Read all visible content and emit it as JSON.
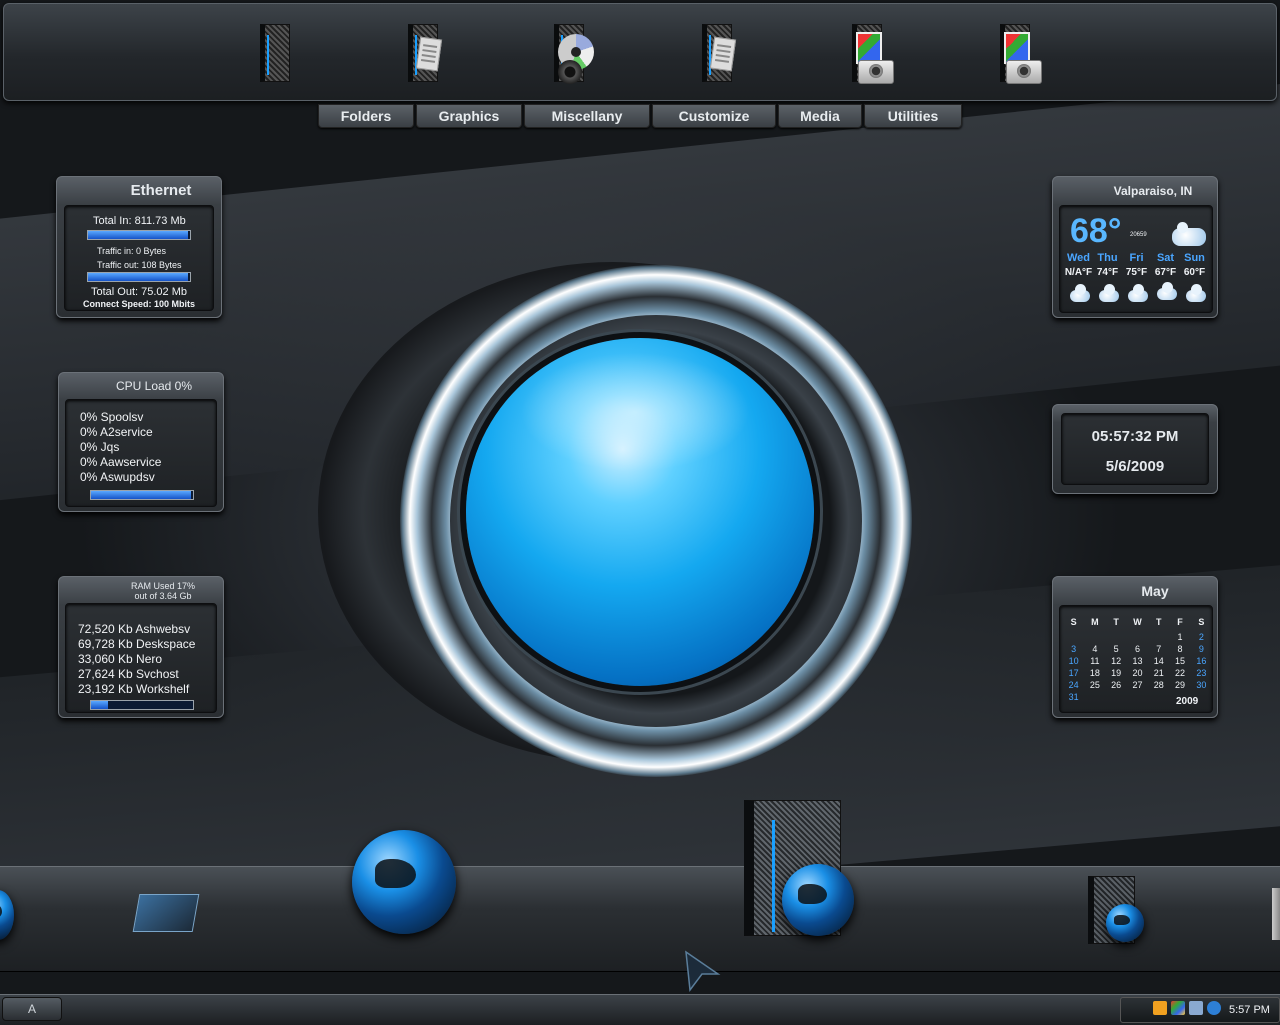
{
  "top_dock": {
    "items": [
      {
        "icon": "folder-icon"
      },
      {
        "icon": "documents-folder-icon"
      },
      {
        "icon": "music-folder-icon"
      },
      {
        "icon": "documents-folder-icon"
      },
      {
        "icon": "pictures-folder-icon"
      },
      {
        "icon": "pictures-folder-icon"
      }
    ]
  },
  "tabs": [
    "Folders",
    "Graphics",
    "Miscellany",
    "Customize",
    "Media",
    "Utilities"
  ],
  "ethernet": {
    "title": "Ethernet",
    "total_in": "Total In: 811.73 Mb",
    "traffic_in": "Traffic in: 0 Bytes",
    "traffic_out": "Traffic out: 108 Bytes",
    "total_out": "Total Out: 75.02 Mb",
    "speed": "Connect Speed: 100 Mbits",
    "in_level": 0.98,
    "out_level": 0.98
  },
  "cpu": {
    "title": "CPU Load 0%",
    "processes": [
      "0% Spoolsv",
      "0% A2service",
      "0% Jqs",
      "0% Aawservice",
      "0% Aswupdsv"
    ],
    "level": 0.98
  },
  "ram": {
    "title_line1": "RAM Used 17%",
    "title_line2": "out of 3.64 Gb",
    "processes": [
      "72,520 Kb Ashwebsv",
      "69,728 Kb Deskspace",
      "33,060 Kb Nero",
      "27,624 Kb Svchost",
      "23,192 Kb Workshelf"
    ],
    "level": 0.17
  },
  "weather": {
    "location": "Valparaiso, IN",
    "temp": "68°",
    "code": "20659",
    "days": [
      "Wed",
      "Thu",
      "Fri",
      "Sat",
      "Sun"
    ],
    "highs": [
      "N/A°F",
      "74°F",
      "75°F",
      "67°F",
      "60°F"
    ],
    "icons": [
      "partly-cloudy-icon",
      "rain-icon",
      "partly-cloudy-icon",
      "cloudy-icon",
      "partly-cloudy-icon"
    ]
  },
  "clock": {
    "time": "05:57:32 PM",
    "date": "5/6/2009"
  },
  "calendar": {
    "month": "May",
    "year": "2009",
    "weekdays": [
      "S",
      "M",
      "T",
      "W",
      "T",
      "F",
      "S"
    ],
    "weeks": [
      [
        "",
        "",
        "",
        "",
        "",
        "1",
        "2"
      ],
      [
        "3",
        "4",
        "5",
        "6",
        "7",
        "8",
        "9"
      ],
      [
        "10",
        "11",
        "12",
        "13",
        "14",
        "15",
        "16"
      ],
      [
        "17",
        "18",
        "19",
        "20",
        "21",
        "22",
        "23"
      ],
      [
        "24",
        "25",
        "26",
        "27",
        "28",
        "29",
        "30"
      ],
      [
        "31",
        "",
        "",
        "",
        "",
        "",
        ""
      ]
    ]
  },
  "taskbar": {
    "start_label": "A",
    "clock": "5:57 PM"
  },
  "colors": {
    "accent": "#1aa0ff",
    "orb": "#14a8f0"
  }
}
